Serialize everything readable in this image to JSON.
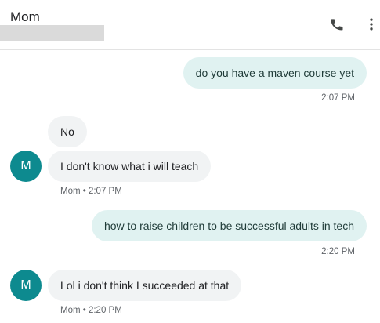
{
  "header": {
    "contact_name": "Mom",
    "call_icon": "phone-icon",
    "more_icon": "more-vert-icon"
  },
  "colors": {
    "outgoing_bubble": "#e0f2f1",
    "incoming_bubble": "#f1f3f4",
    "avatar": "#0d8a8f"
  },
  "messages": [
    {
      "direction": "outgoing",
      "text": "do you have a maven course yet",
      "time": "2:07 PM"
    },
    {
      "direction": "incoming",
      "text": "No"
    },
    {
      "direction": "incoming",
      "text": "I don't know what i will teach",
      "sender_initial": "M",
      "meta": "Mom • 2:07 PM"
    },
    {
      "direction": "outgoing",
      "text": "how to raise children to be successful adults in tech",
      "time": "2:20 PM"
    },
    {
      "direction": "incoming",
      "text": "Lol i don't think I succeeded at that",
      "sender_initial": "M",
      "meta": "Mom • 2:20 PM"
    }
  ]
}
